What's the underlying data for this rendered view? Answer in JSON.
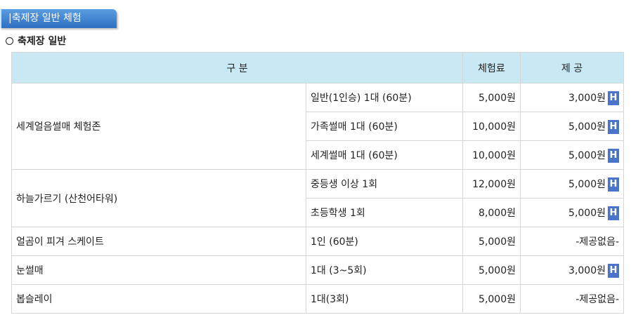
{
  "section_title": "|축제장 일반 체험",
  "subheading": "축제장 일반",
  "table": {
    "headers": {
      "category": "구 분",
      "fee": "체험료",
      "offer": "제 공"
    },
    "groups": [
      {
        "name": "세계얼음썰매 체험존",
        "rows": [
          {
            "detail": "일반(1인승) 1대 (60분)",
            "fee": "5,000원",
            "offer": "3,000원",
            "badge": "H"
          },
          {
            "detail": "가족썰매 1대 (60분)",
            "fee": "10,000원",
            "offer": "5,000원",
            "badge": "H"
          },
          {
            "detail": "세계썰매 1대 (60분)",
            "fee": "10,000원",
            "offer": "5,000원",
            "badge": "H"
          }
        ]
      },
      {
        "name": "하늘가르기 (산천어타워)",
        "rows": [
          {
            "detail": "중등생 이상 1회",
            "fee": "12,000원",
            "offer": "5,000원",
            "badge": "H"
          },
          {
            "detail": "초등학생 1회",
            "fee": "8,000원",
            "offer": "5,000원",
            "badge": "H"
          }
        ]
      },
      {
        "name": "얼곰이 피겨 스케이트",
        "rows": [
          {
            "detail": "1인 (60분)",
            "fee": "5,000원",
            "offer": "-제공없음-",
            "badge": ""
          }
        ]
      },
      {
        "name": "눈썰매",
        "rows": [
          {
            "detail": "1대 (3~5회)",
            "fee": "5,000원",
            "offer": "3,000원",
            "badge": "H"
          }
        ]
      },
      {
        "name": "봅슬레이",
        "rows": [
          {
            "detail": "1대(3회)",
            "fee": "5,000원",
            "offer": "-제공없음-",
            "badge": ""
          }
        ]
      }
    ]
  },
  "colors": {
    "header_bg": "#c8e8f4",
    "tab_bg": "#3d82d2",
    "badge_bg": "#4a74c9"
  }
}
